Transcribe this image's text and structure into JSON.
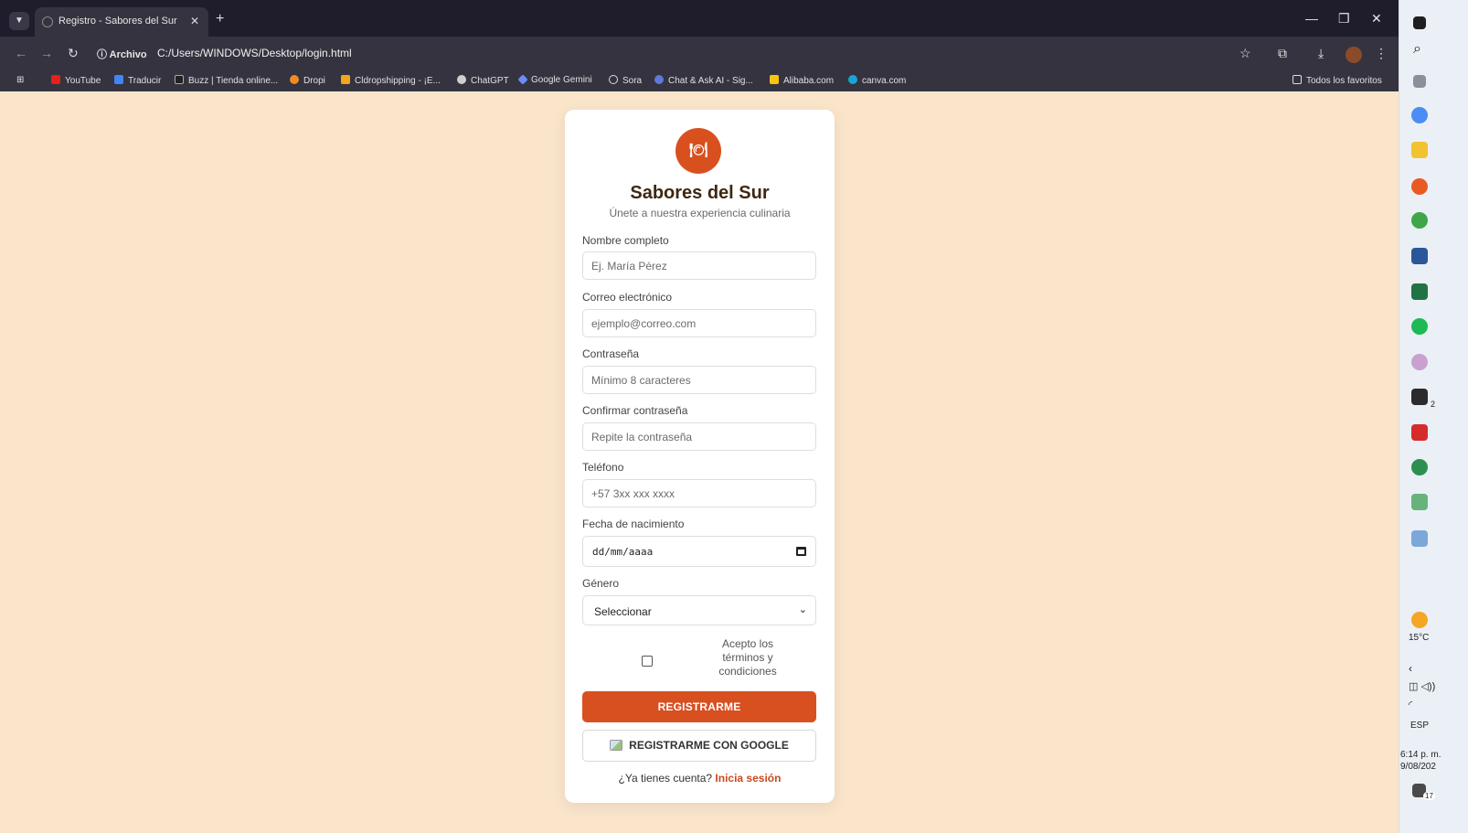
{
  "browser": {
    "tab_title": "Registro - Sabores del Sur",
    "address_chip": "ⓘ Archivo",
    "url": "C:/Users/WINDOWS/Desktop/login.html",
    "bookmarks": [
      "YouTube",
      "Traducir",
      "Buzz | Tienda online...",
      "Dropi",
      "Cldropshipping - ¡E...",
      "ChatGPT",
      "Google Gemini",
      "Sora",
      "Chat & Ask AI - Sig...",
      "Alibaba.com",
      "canva.com"
    ],
    "all_bookmarks": "Todos los favoritos"
  },
  "form": {
    "brand": "Sabores del Sur",
    "tagline": "Únete a nuestra experiencia culinaria",
    "fields": [
      {
        "label": "Nombre completo",
        "placeholder": "Ej. María Pérez"
      },
      {
        "label": "Correo electrónico",
        "placeholder": "ejemplo@correo.com"
      },
      {
        "label": "Contraseña",
        "placeholder": "Mínimo 8 caracteres"
      },
      {
        "label": "Confirmar contraseña",
        "placeholder": "Repite la contraseña"
      },
      {
        "label": "Teléfono",
        "placeholder": "+57 3xx xxx xxxx"
      }
    ],
    "birth_label": "Fecha de nacimiento",
    "birth_placeholder": "dd/mm/aaaa",
    "gender_label": "Género",
    "gender_value": "Seleccionar",
    "terms_text": "Acepto los términos y condiciones",
    "register_button": "REGISTRARME",
    "google_button": "REGISTRARME CON GOOGLE",
    "login_prompt": "¿Ya tienes cuenta?",
    "login_link": "Inicia sesión"
  },
  "taskbar": {
    "weather": "15°C",
    "language": "ESP",
    "time": "6:14 p. m.",
    "date": "9/08/202",
    "notification_count": "17",
    "xbox_badge": "2"
  },
  "colors": {
    "page_bg": "#fae5cb",
    "accent": "#d84f20",
    "brand_text": "#3e2712"
  }
}
